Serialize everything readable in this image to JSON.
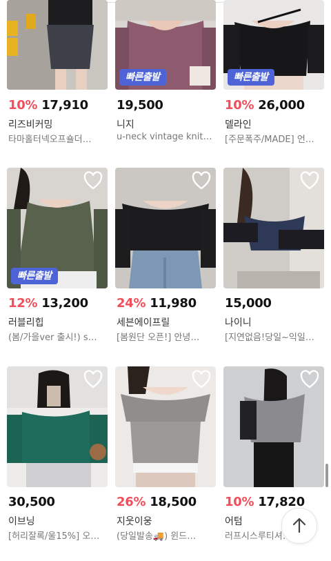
{
  "filter_chips": [
    "",
    "",
    "",
    ""
  ],
  "badge_label": "빠른출발",
  "products": [
    {
      "discount": "10%",
      "price": "17,910",
      "store": "리즈비커밍",
      "desc": "타마홀터넥오프숄더…",
      "fast": false,
      "heart": false
    },
    {
      "discount": "",
      "price": "19,500",
      "store": "니지",
      "desc": "u-neck vintage knit…",
      "fast": true,
      "heart": false
    },
    {
      "discount": "10%",
      "price": "26,000",
      "store": "델라인",
      "desc": "[주문폭주/MADE] 언…",
      "fast": true,
      "heart": false
    },
    {
      "discount": "12%",
      "price": "13,200",
      "store": "러블리힙",
      "desc": "(봄/가을ver 출시!) s…",
      "fast": true,
      "heart": true
    },
    {
      "discount": "24%",
      "price": "11,980",
      "store": "세븐에이프릴",
      "desc": "[봄원단 오픈!] 안녕…",
      "fast": false,
      "heart": true
    },
    {
      "discount": "",
      "price": "15,000",
      "store": "나이니",
      "desc": "[지연없음!당일~익일…",
      "fast": false,
      "heart": true
    },
    {
      "discount": "",
      "price": "30,500",
      "store": "이브닝",
      "desc": "[허리잘록/울15%] 오…",
      "fast": false,
      "heart": true
    },
    {
      "discount": "26%",
      "price": "18,500",
      "store": "지웃이웅",
      "desc": "(당일발송🚚) 윈드…",
      "fast": false,
      "heart": true
    },
    {
      "discount": "10%",
      "price": "17,820",
      "store": "어텀",
      "desc": "러프시스루티셔…",
      "fast": false,
      "heart": true
    }
  ],
  "scroll_top_icon": "arrow-up-icon",
  "colors": {
    "discount": "#f04e5a",
    "badge": "#4d63d6"
  }
}
